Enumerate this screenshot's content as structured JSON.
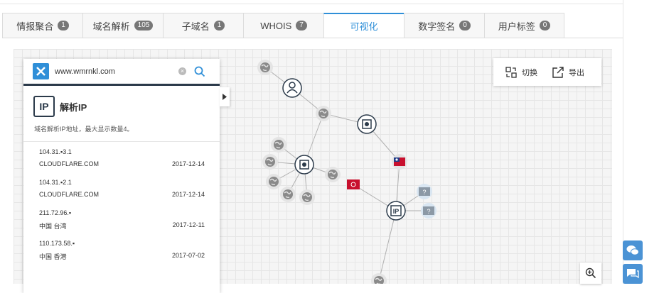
{
  "tabs": [
    {
      "label": "情报聚合",
      "count": "1"
    },
    {
      "label": "域名解析",
      "count": "105"
    },
    {
      "label": "子域名",
      "count": "1"
    },
    {
      "label": "WHOIS",
      "count": "7"
    },
    {
      "label": "可视化",
      "count": ""
    },
    {
      "label": "数字签名",
      "count": "0"
    },
    {
      "label": "用户标签",
      "count": "0"
    }
  ],
  "active_tab": "可视化",
  "search": {
    "value": "www.wmrnkl.com"
  },
  "ip_panel": {
    "title": "解析IP",
    "icon_label": "IP",
    "description": "域名解析IP地址，最大显示数量4。",
    "entries": [
      {
        "ip": "104.31.▪3.1",
        "org": "CLOUDFLARE.COM",
        "date": "2017-12-14"
      },
      {
        "ip": "104.31.▪2.1",
        "org": "CLOUDFLARE.COM",
        "date": "2017-12-14"
      },
      {
        "ip": "211.72.96.▪",
        "org": "中国 台湾",
        "date": "2017-12-11"
      },
      {
        "ip": "110.173.58.▪",
        "org": "中国 香港",
        "date": "2017-07-02"
      }
    ]
  },
  "toolbar": {
    "switch_label": "切换",
    "export_label": "导出"
  },
  "graph": {
    "node_icons": {
      "globe": "globe-icon",
      "user": "user-icon",
      "domain": "domain-icon",
      "ip": "ip-icon",
      "unknown": "unknown-icon",
      "flag_tw": "flag-taiwan-icon",
      "flag_hk": "flag-hongkong-icon"
    },
    "ip_node_label": "IP",
    "unknown_label": "?"
  },
  "colors": {
    "accent": "#2f8fd8",
    "dark": "#2b3a4a",
    "float": "#4b93d5"
  }
}
